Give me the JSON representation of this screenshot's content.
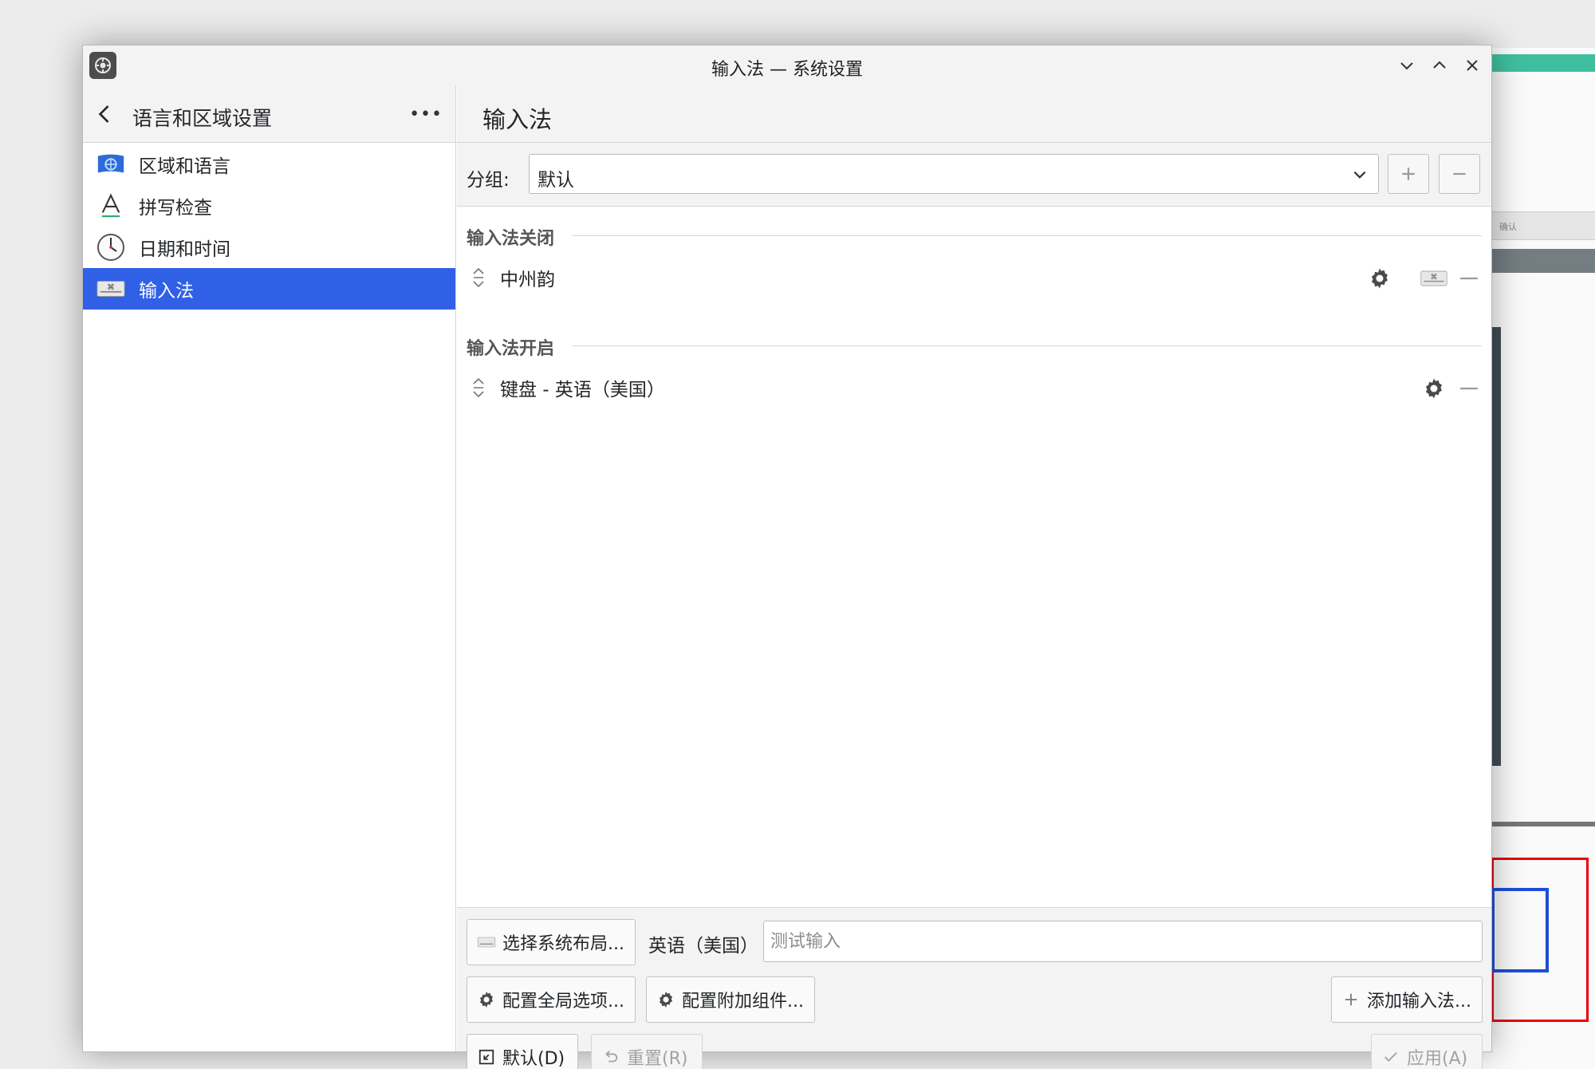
{
  "window": {
    "title": "输入法 — 系统设置"
  },
  "sidebar": {
    "title": "语言和区域设置",
    "more": "•••",
    "items": [
      {
        "label": "区域和语言",
        "icon": "flag-globe-icon"
      },
      {
        "label": "拼写检查",
        "icon": "letter-a-icon"
      },
      {
        "label": "日期和时间",
        "icon": "clock-icon"
      },
      {
        "label": "输入法",
        "icon": "keyboard-icon",
        "active": true
      }
    ]
  },
  "main": {
    "title": "输入法",
    "group_label": "分组:",
    "group_value": "默认",
    "sections": [
      {
        "heading": "输入法关闭",
        "items": [
          {
            "name": "中州韵"
          }
        ]
      },
      {
        "heading": "输入法开启",
        "items": [
          {
            "name": "键盘 - 英语（美国）"
          }
        ]
      }
    ]
  },
  "bottom": {
    "select_layout": "选择系统布局...",
    "layout_name": "英语（美国）",
    "test_placeholder": "测试输入",
    "global_options": "配置全局选项...",
    "addons": "配置附加组件...",
    "add_im": "添加输入法...",
    "defaults": "默认(D)",
    "reset": "重置(R)",
    "apply": "应用(A)"
  },
  "background": {
    "fragment_text": "确认"
  },
  "colors": {
    "accent": "#3060e6",
    "panel": "#f3f3f3"
  }
}
